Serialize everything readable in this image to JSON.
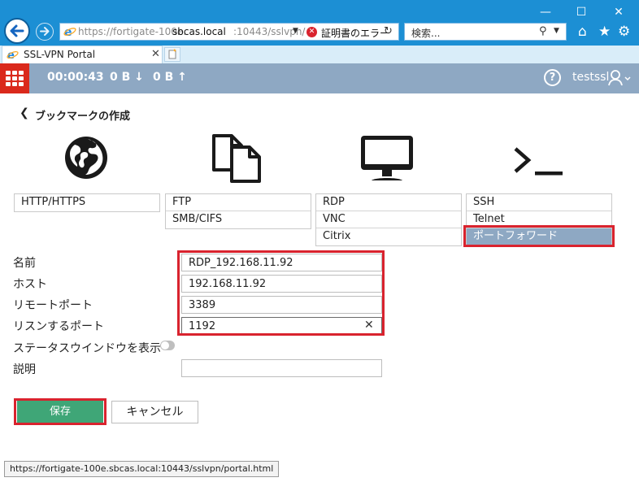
{
  "browser": {
    "address_dim": "https://fortigate-100e.",
    "address_host": "sbcas.local",
    "address_tail": ":10443/sslvpn/",
    "cert_error": "証明書のエラー",
    "search_placeholder": "検索...",
    "tab_title": "SSL-VPN Portal",
    "status_url": "https://fortigate-100e.sbcas.local:10443/sslvpn/portal.html"
  },
  "header": {
    "session_time": "00:00:43",
    "bytes_down": "0 B",
    "bytes_up": "0 B",
    "help": "?",
    "username": "testssl"
  },
  "page": {
    "back_label": "ブックマークの作成"
  },
  "categories": {
    "web": [
      "HTTP/HTTPS"
    ],
    "file": [
      "FTP",
      "SMB/CIFS"
    ],
    "desktop": [
      "RDP",
      "VNC",
      "Citrix"
    ],
    "shell": [
      "SSH",
      "Telnet",
      "ポートフォワード"
    ]
  },
  "form": {
    "name_label": "名前",
    "name_value": "RDP_192.168.11.92",
    "host_label": "ホスト",
    "host_value": "192.168.11.92",
    "remote_port_label": "リモートポート",
    "remote_port_value": "3389",
    "listen_port_label": "リスンするポート",
    "listen_port_value": "1192",
    "status_window_label": "ステータスウインドウを表示",
    "status_window_on": false,
    "description_label": "説明",
    "description_value": ""
  },
  "buttons": {
    "save": "保存",
    "cancel": "キャンセル"
  },
  "colors": {
    "chrome": "#1c8fd4",
    "header": "#8ea8c3",
    "logo": "#da291c",
    "save": "#3fa677",
    "highlight": "#d9232e"
  }
}
